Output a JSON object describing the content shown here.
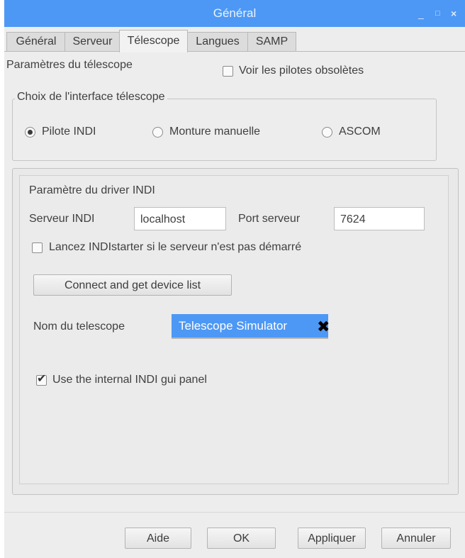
{
  "window": {
    "title": "Général",
    "controls": {
      "minimize": "_",
      "maximize": "□",
      "close": "×"
    }
  },
  "tabs": [
    {
      "label": "Général",
      "active": false
    },
    {
      "label": "Serveur",
      "active": false
    },
    {
      "label": "Télescope",
      "active": true
    },
    {
      "label": "Langues",
      "active": false
    },
    {
      "label": "SAMP",
      "active": false
    }
  ],
  "telescope": {
    "section_label": "Paramètres du télescope",
    "obsolete_drivers": {
      "label": "Voir les pilotes obsolètes",
      "checked": false
    },
    "interface_group": {
      "title": "Choix de l'interface télescope",
      "options": [
        {
          "label": "Pilote INDI",
          "selected": true
        },
        {
          "label": "Monture manuelle",
          "selected": false
        },
        {
          "label": "ASCOM",
          "selected": false
        }
      ]
    },
    "indi": {
      "title": "Paramètre du driver INDI",
      "server_label": "Serveur INDI",
      "server_value": "localhost",
      "port_label": "Port serveur",
      "port_value": "7624",
      "indistarter": {
        "label": "Lancez INDIstarter si le serveur n'est pas démarré",
        "checked": false
      },
      "connect_button": "Connect and get device list",
      "telescope_name_label": "Nom du telescope",
      "telescope_name_value": "Telescope Simulator",
      "internal_gui": {
        "label": "Use the internal INDI gui panel",
        "checked": true
      }
    }
  },
  "footer": {
    "help": "Aide",
    "ok": "OK",
    "apply": "Appliquer",
    "cancel": "Annuler"
  },
  "icons": {
    "check_mark": "✔",
    "clear": "✖"
  }
}
